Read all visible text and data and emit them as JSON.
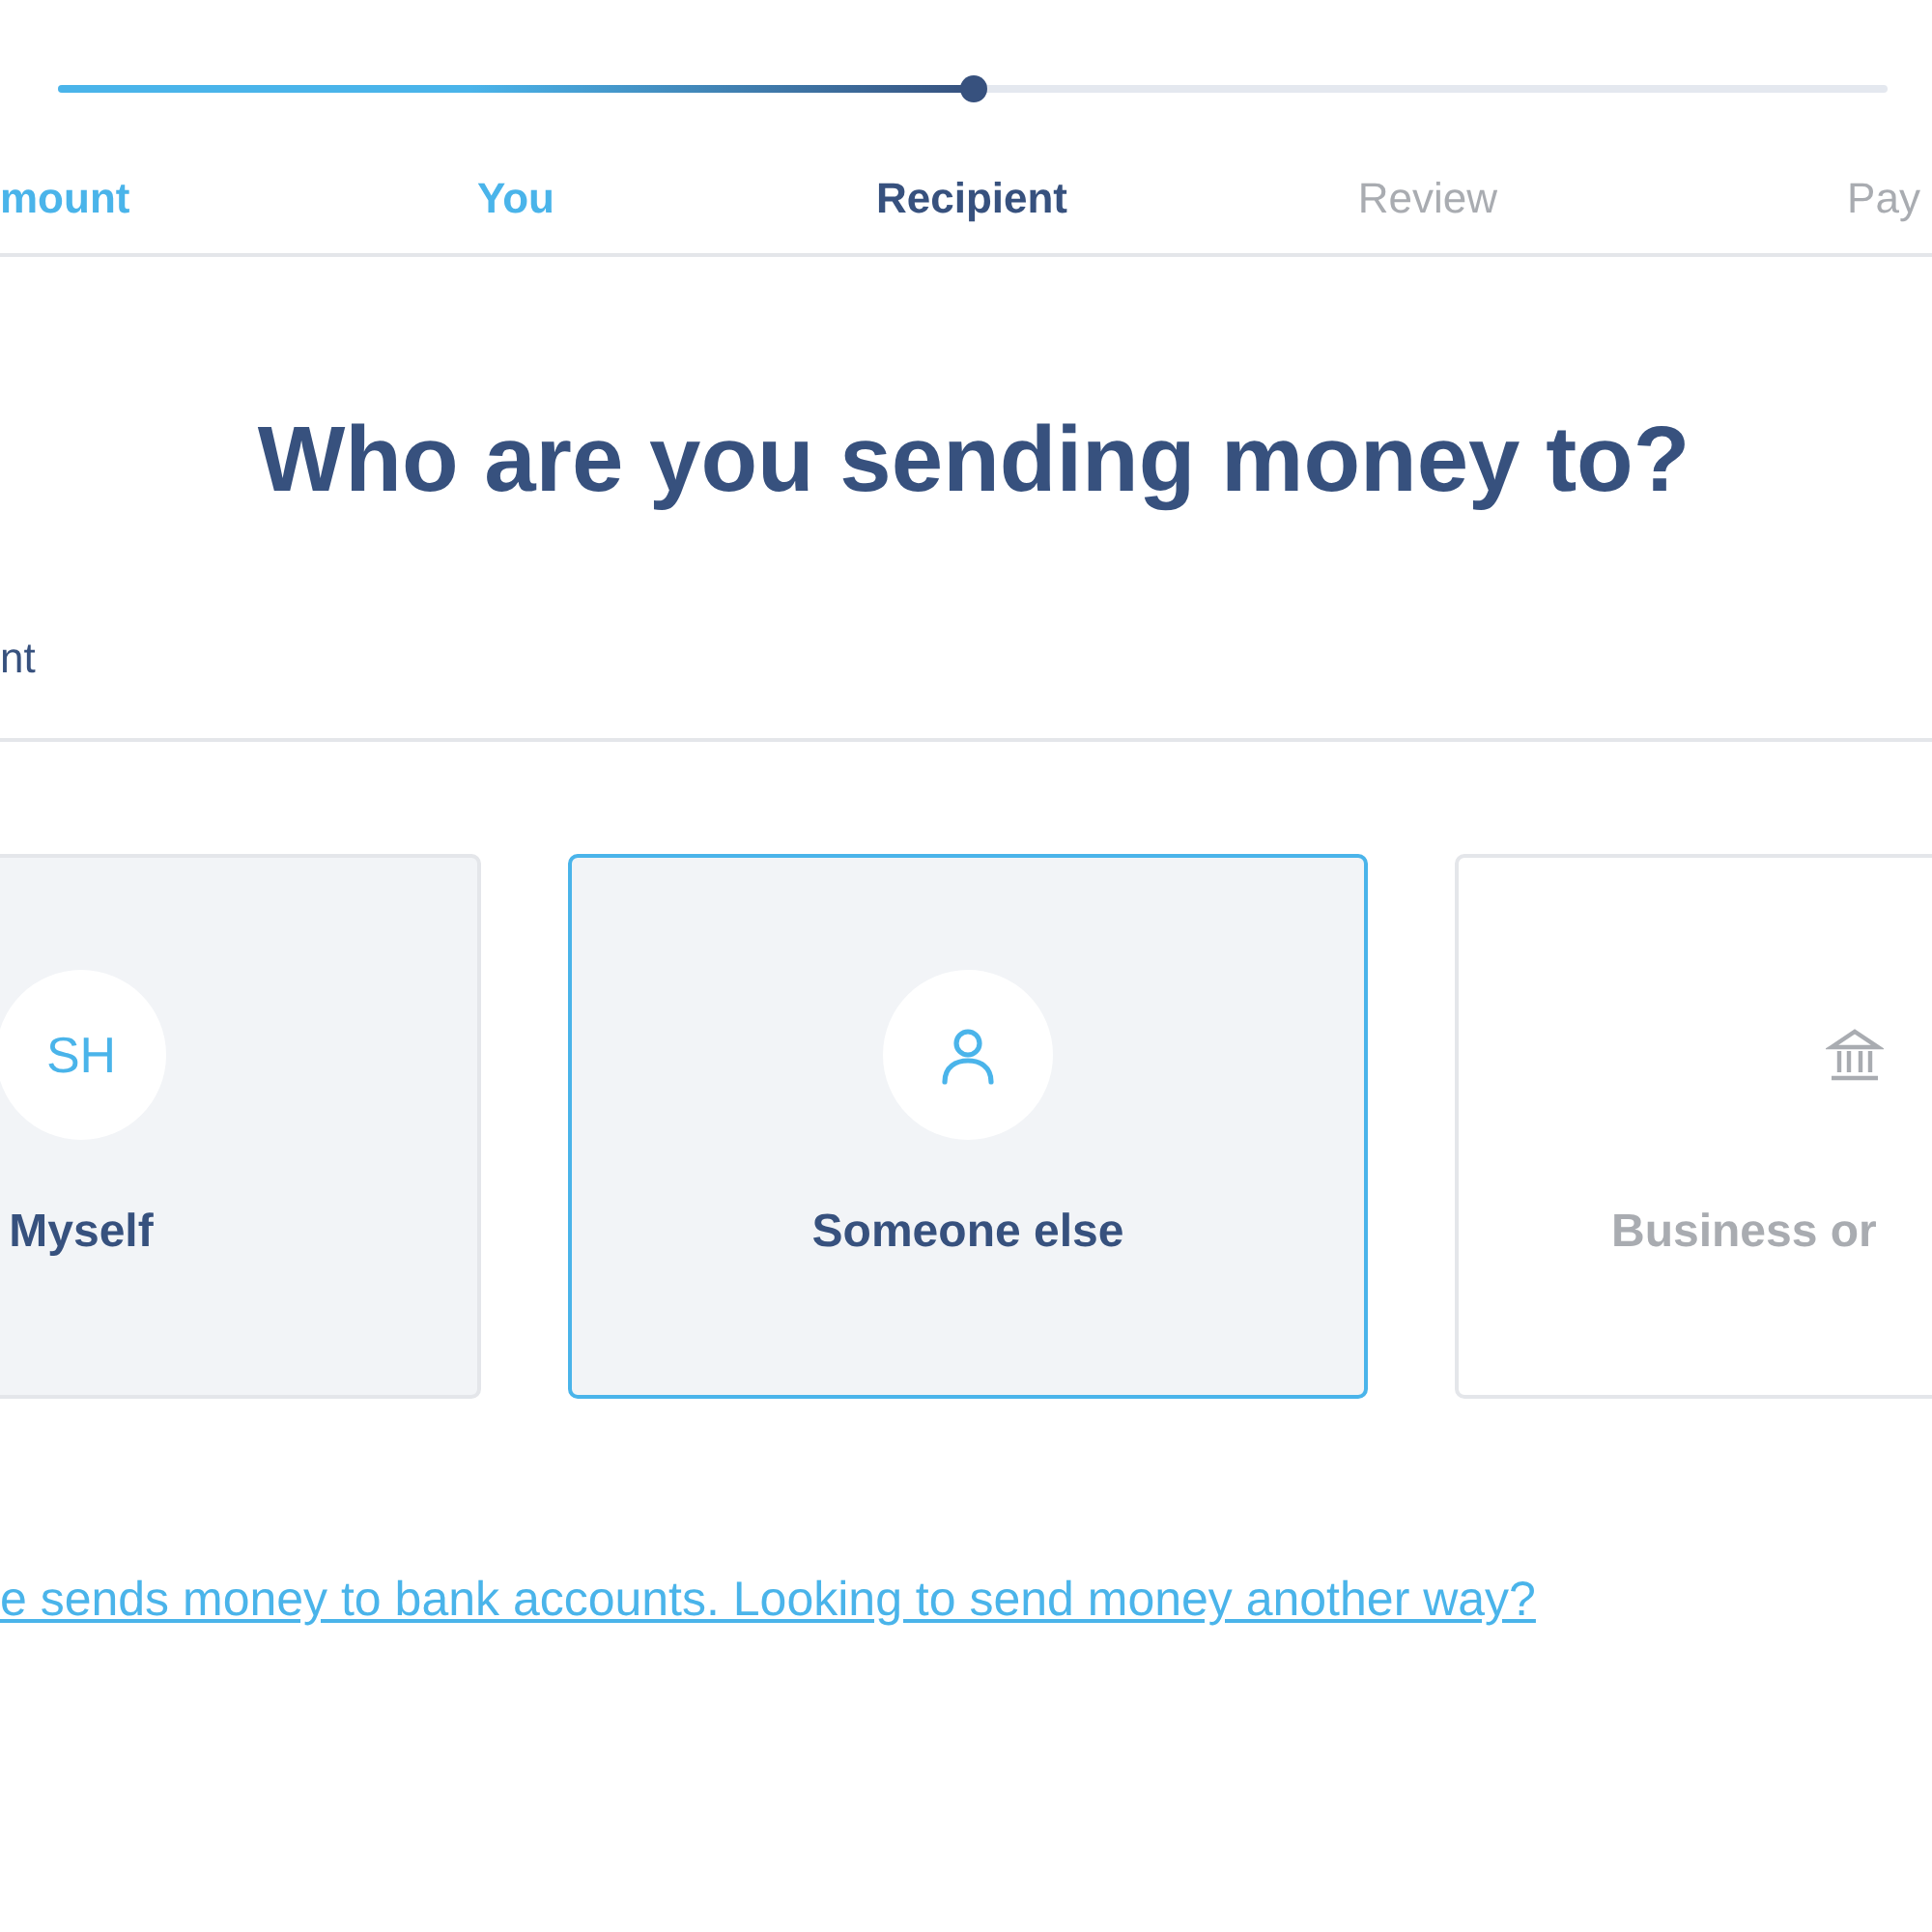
{
  "progress": {
    "level": 0.5
  },
  "steps": [
    {
      "label": "mount",
      "completed": true,
      "selected": false
    },
    {
      "label": "You",
      "completed": true,
      "selected": false
    },
    {
      "label": "Recipient",
      "completed": false,
      "selected": true
    },
    {
      "label": "Review",
      "completed": false,
      "selected": false
    },
    {
      "label": "Pay",
      "completed": false,
      "selected": false
    }
  ],
  "heading": "Who are you sending money to?",
  "section_label": "nt",
  "options": [
    {
      "kind": "initials",
      "initials": "SH",
      "label": "Myself",
      "selected": false,
      "disabled": false
    },
    {
      "kind": "person",
      "label": "Someone else",
      "selected": true,
      "disabled": false
    },
    {
      "kind": "bank",
      "label": "Business or",
      "selected": false,
      "disabled": true
    }
  ],
  "footer_link": "e sends money to bank accounts. Looking to send money another way?"
}
